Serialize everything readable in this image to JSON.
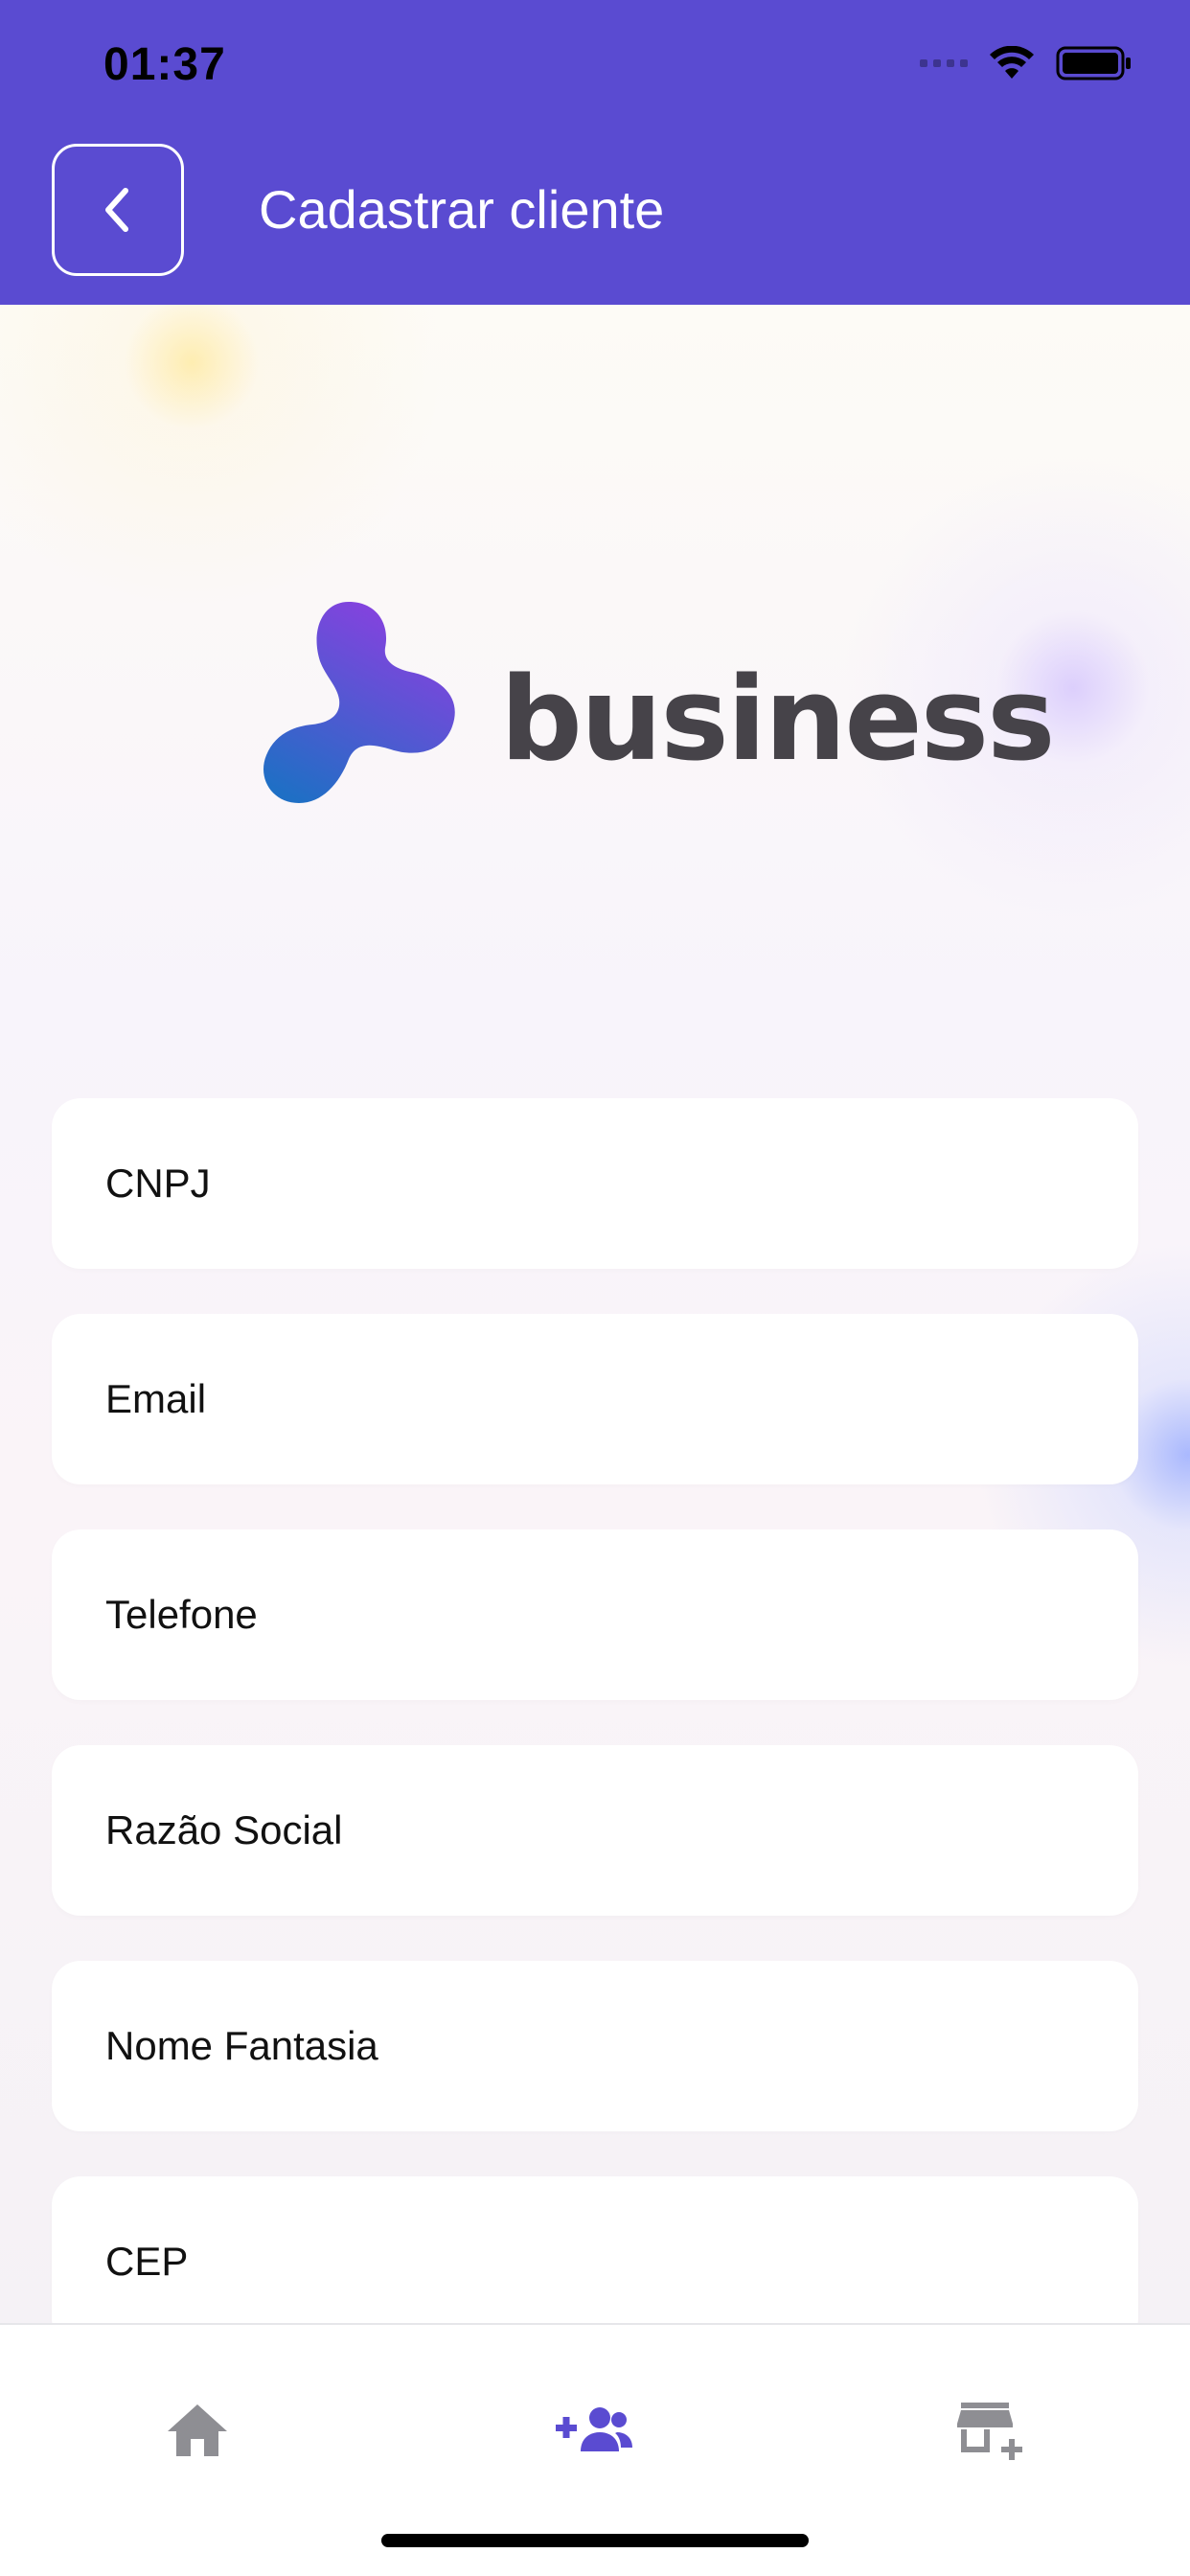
{
  "status_bar": {
    "time": "01:37"
  },
  "header": {
    "title": "Cadastrar cliente"
  },
  "logo": {
    "text": "business"
  },
  "form": {
    "fields": [
      {
        "placeholder": "CNPJ"
      },
      {
        "placeholder": "Email"
      },
      {
        "placeholder": "Telefone"
      },
      {
        "placeholder": "Razão Social"
      },
      {
        "placeholder": "Nome Fantasia"
      },
      {
        "placeholder": "CEP"
      }
    ]
  },
  "tab_bar": {
    "tabs": [
      {
        "icon": "home-icon",
        "active": false
      },
      {
        "icon": "add-user-icon",
        "active": true
      },
      {
        "icon": "add-store-icon",
        "active": false
      }
    ]
  },
  "colors": {
    "primary": "#5a4bd1",
    "inactive_icon": "#8e8e93",
    "background": "#faf8fb"
  }
}
